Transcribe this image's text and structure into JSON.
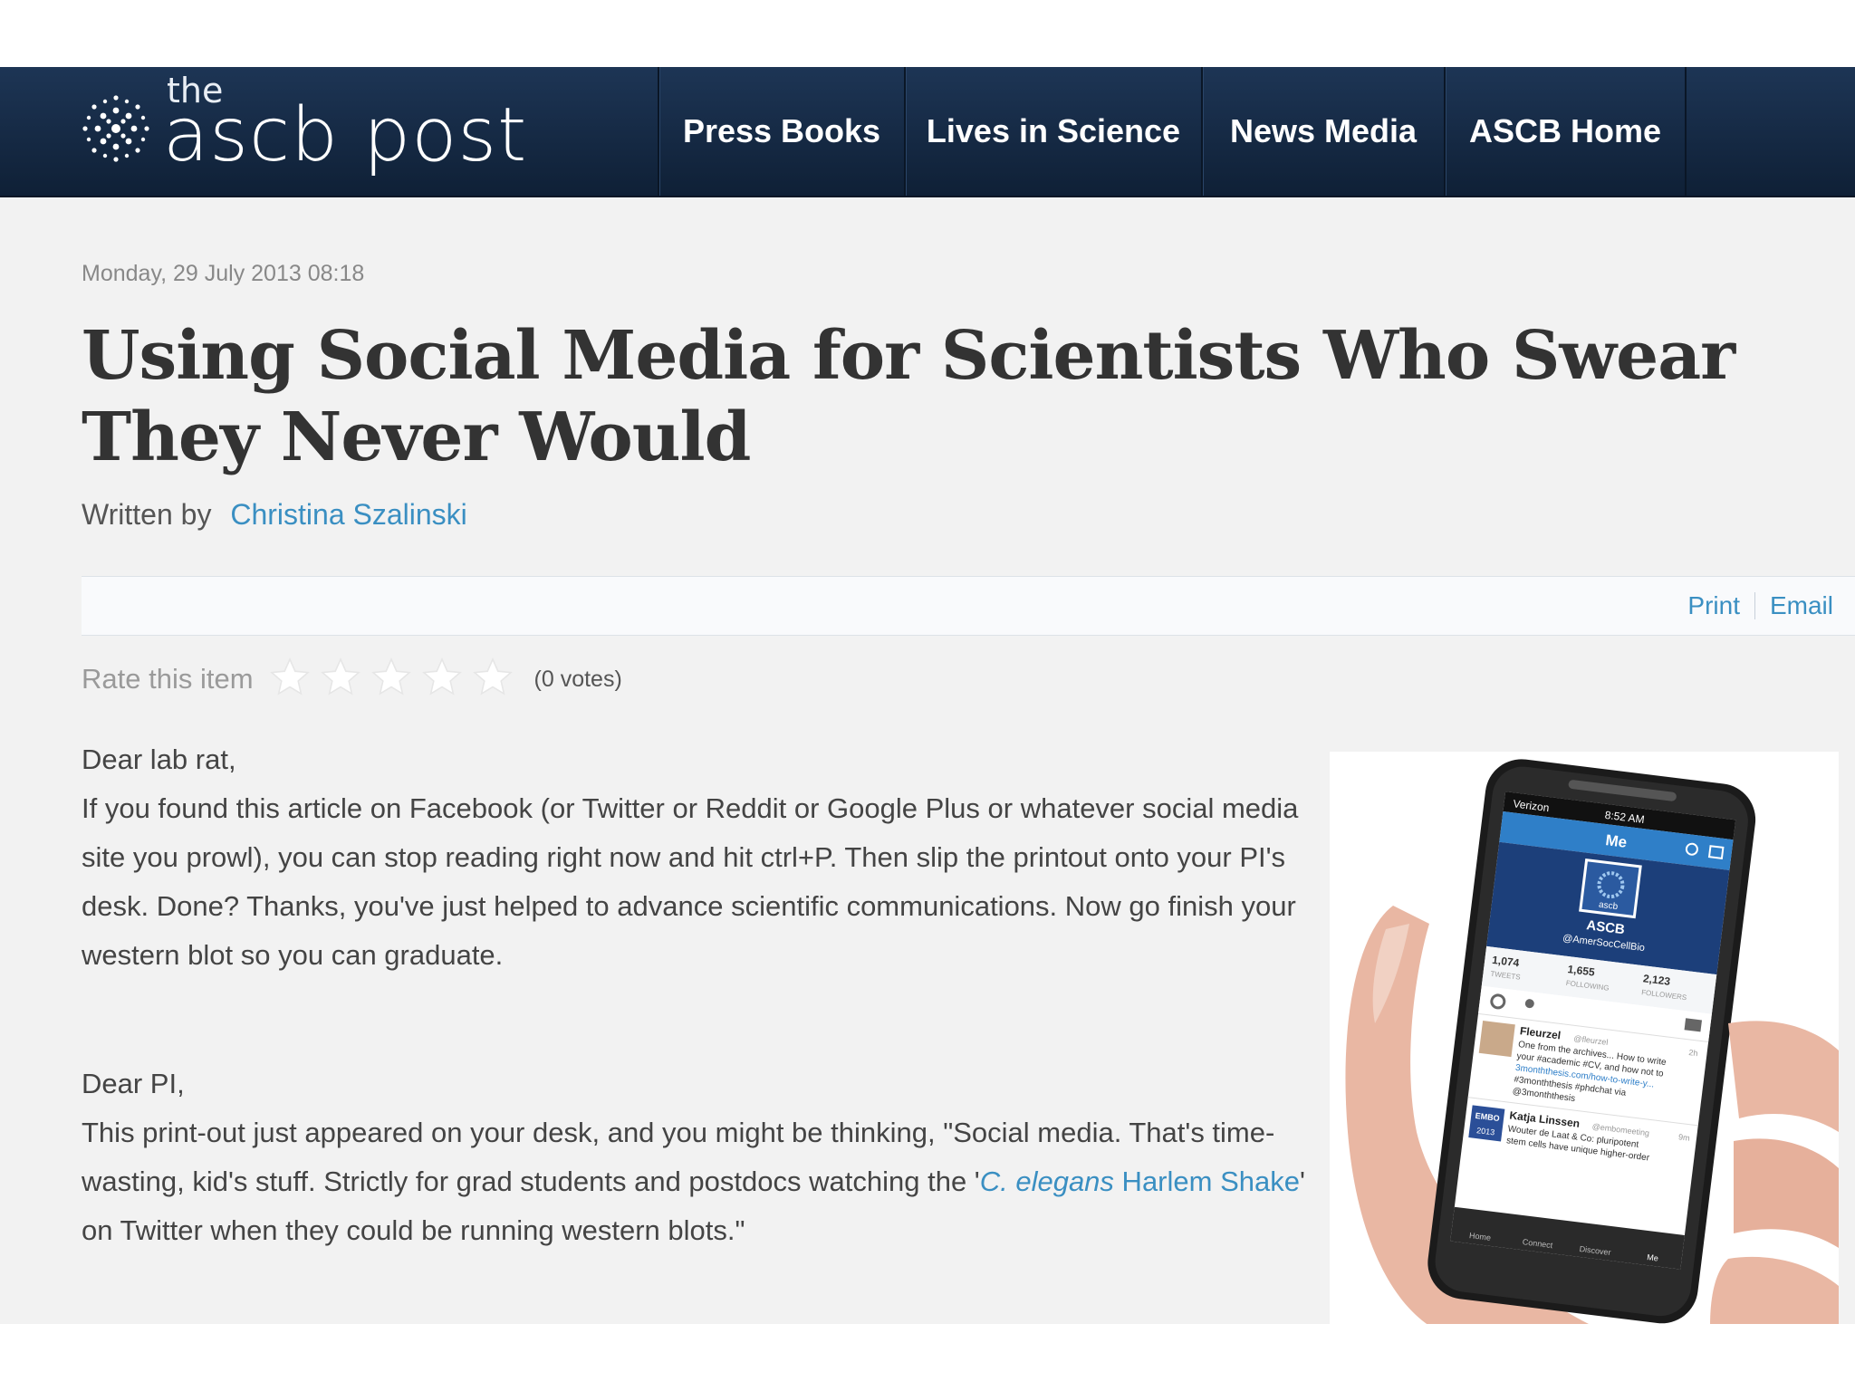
{
  "header": {
    "logo_the": "the",
    "logo_name": "ascb post",
    "nav": [
      "Press Books",
      "Lives in Science",
      "News Media",
      "ASCB Home"
    ]
  },
  "article": {
    "date": "Monday, 29 July 2013 08:18",
    "title": "Using Social Media for Scientists Who Swear They Never Would",
    "byline_label": "Written by",
    "author": "Christina Szalinski",
    "tools": {
      "print": "Print",
      "email": "Email"
    },
    "rating": {
      "label": "Rate this item",
      "stars_total": 5,
      "stars_filled": 0,
      "votes": "(0 votes)"
    },
    "greeting1": "Dear lab rat,",
    "paragraph1": "If you found this article on Facebook (or Twitter or Reddit or Google Plus or whatever social media site you prowl), you can stop reading right now and hit ctrl+P. Then slip the printout onto your PI's desk. Done? Thanks, you've just helped to advance scientific communications. Now go finish your western blot so you can graduate.",
    "greeting2": "Dear PI,",
    "paragraph2_before": "This print-out just appeared on your desk, and you might be thinking, \"Social media. That's time-wasting, kid's stuff. Strictly for grad students and postdocs watching the '",
    "paragraph2_link_italic": "C. elegans",
    "paragraph2_link_rest": " Harlem Shake",
    "paragraph2_after": "' on Twitter when they could be running western blots.\""
  },
  "phone_screen": {
    "carrier": "Verizon",
    "time": "8:52 AM",
    "tab_title": "Me",
    "avatar_text": "ascb",
    "profile_name": "ASCB",
    "profile_handle": "@AmerSocCellBio",
    "stats": [
      {
        "value": "1,074",
        "label": "TWEETS"
      },
      {
        "value": "1,655",
        "label": "FOLLOWING"
      },
      {
        "value": "2,123",
        "label": "FOLLOWERS"
      }
    ],
    "tweets": [
      {
        "name": "Fleurzel",
        "handle": "@fleurzel",
        "age": "2h",
        "lines": [
          "One from the archives... How to write",
          "your #academic #CV, and how not to",
          "3monththesis.com/how-to-write-y...",
          "#3monththesis #phdchat via",
          "@3monththesis"
        ]
      },
      {
        "name": "Katja Linssen",
        "handle": "@embomeeting",
        "age": "9m",
        "avatar_lines": [
          "EMBO",
          "2013"
        ],
        "lines": [
          "Wouter de Laat & Co: pluripotent",
          "stem cells have unique higher-order"
        ]
      }
    ],
    "tabbar": [
      "Home",
      "Connect",
      "Discover",
      "Me"
    ]
  },
  "colors": {
    "header_bg": "#152a45",
    "link": "#3a8fc2",
    "body_bg": "#f2f2f2",
    "title_text": "#333333"
  }
}
